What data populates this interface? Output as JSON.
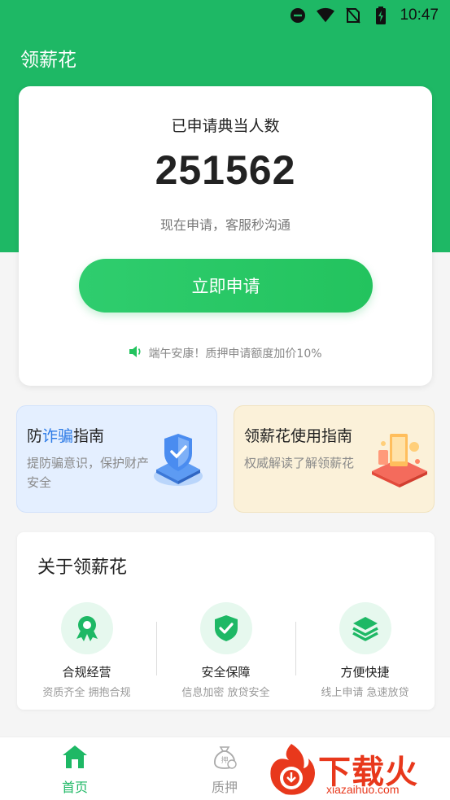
{
  "status_bar": {
    "time": "10:47"
  },
  "app": {
    "title": "领薪花"
  },
  "hero": {
    "label": "已申请典当人数",
    "count": "251562",
    "subtitle": "现在申请，客服秒沟通",
    "apply_button": "立即申请",
    "notice": "端午安康！质押申请额度加价10%"
  },
  "guides": [
    {
      "title_pre": "防",
      "title_highlight": "诈骗",
      "title_post": "指南",
      "desc": "提防骗意识，保护财产安全",
      "icon": "shield-icon"
    },
    {
      "title": "领薪花使用指南",
      "desc": "权威解读了解领薪花",
      "icon": "guide-illustration-icon"
    }
  ],
  "about": {
    "title": "关于领薪花",
    "features": [
      {
        "name": "合规经营",
        "desc": "资质齐全 拥抱合规",
        "icon": "award-icon"
      },
      {
        "name": "安全保障",
        "desc": "信息加密 放贷安全",
        "icon": "shield-check-icon"
      },
      {
        "name": "方便快捷",
        "desc": "线上申请 急速放贷",
        "icon": "layers-icon"
      }
    ]
  },
  "nav": [
    {
      "label": "首页",
      "icon": "home-icon",
      "active": true
    },
    {
      "label": "质押",
      "icon": "pledge-bag-icon",
      "active": false
    }
  ],
  "watermark": {
    "text": "下载火",
    "url": "xiazaihuo.com"
  },
  "colors": {
    "brand_green": "#1eb865",
    "highlight_blue": "#2a79e6",
    "watermark_red": "#e8381c"
  }
}
